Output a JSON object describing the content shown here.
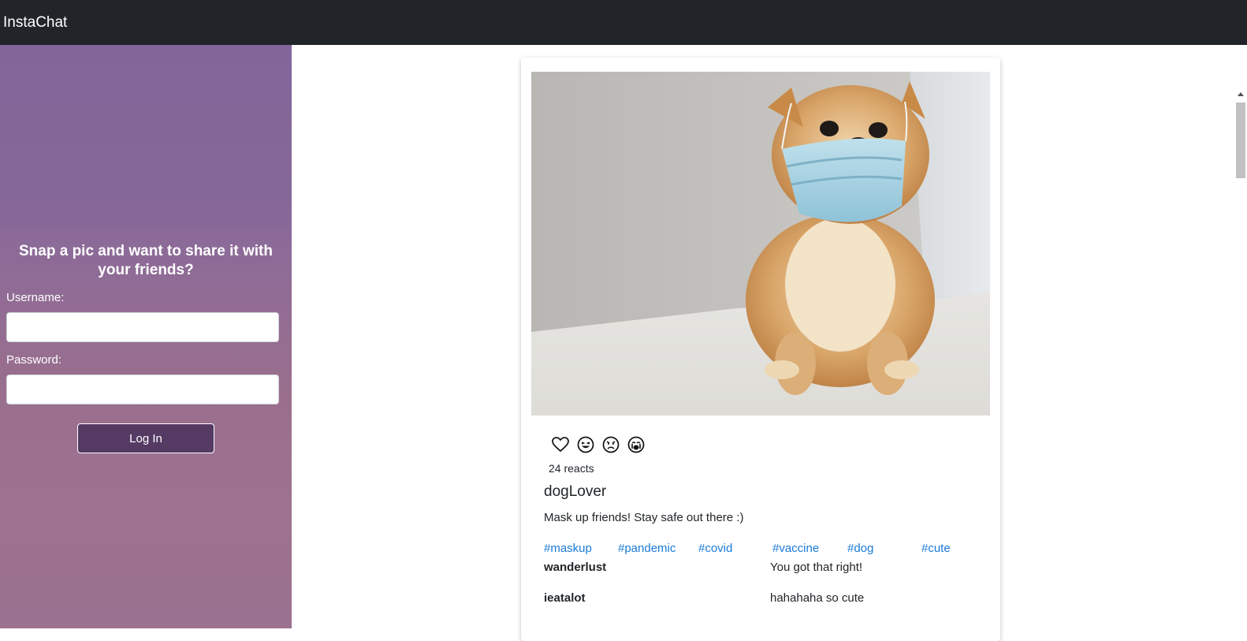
{
  "navbar": {
    "brand": "InstaChat"
  },
  "login": {
    "tagline": "Snap a pic and want to share it with your friends?",
    "username_label": "Username:",
    "username_value": "",
    "password_label": "Password:",
    "password_value": "",
    "submit_label": "Log In"
  },
  "post": {
    "image_subject": "pomeranian dog wearing a face mask",
    "reactions": [
      "heart-icon",
      "laughing-face-icon",
      "angry-face-icon",
      "crying-face-icon"
    ],
    "react_count": "24 reacts",
    "username": "dogLover",
    "caption": "Mask up friends! Stay safe out there :)",
    "tags": [
      "#maskup",
      "#pandemic",
      "#covid",
      "#vaccine",
      "#dog",
      "#cute"
    ],
    "comments": [
      {
        "user": "wanderlust",
        "text": "You got that right!"
      },
      {
        "user": "ieatalot",
        "text": "hahahaha so cute"
      }
    ]
  },
  "colors": {
    "navbar_bg": "#212529",
    "sidebar_gradient_top": "#86679c",
    "sidebar_gradient_bottom": "#9b7291",
    "login_button_bg": "#553a63",
    "tag_link": "#1a7bd8"
  }
}
